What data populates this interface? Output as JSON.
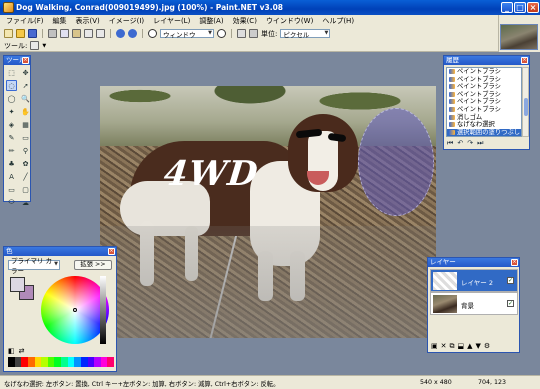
{
  "window": {
    "title": "Dog Walking, Conrad(009019499).jpg (100%) - Paint.NET v3.08"
  },
  "menu": {
    "items": [
      "ファイル(F)",
      "編集",
      "表示(V)",
      "イメージ(I)",
      "レイヤー(L)",
      "調整(A)",
      "効果(C)",
      "ウインドウ(W)",
      "ヘルプ(H)"
    ]
  },
  "toolbar": {
    "zoom_label": "ウィンドウ",
    "units_label": "単位:",
    "units_value": "ピクセル",
    "tools_label": "ツール:"
  },
  "canvas": {
    "painted_text": "4WD"
  },
  "tools_panel": {
    "title": "ツール"
  },
  "history_panel": {
    "title": "履歴",
    "items": [
      "ペイントブラシ",
      "ペイントブラシ",
      "ペイントブラシ",
      "ペイントブラシ",
      "ペイントブラシ",
      "ペイントブラシ",
      "消しゴム",
      "なげなわ選択",
      "選択範囲の塗りつぶし"
    ]
  },
  "colors_panel": {
    "title": "色",
    "mode": "プライマリ カラー",
    "more_button": "拡張 >>",
    "primary_color": "#dcd7e2",
    "secondary_color": "#b08ab8"
  },
  "layers_panel": {
    "title": "レイヤー",
    "layers": [
      {
        "name": "レイヤー 2",
        "visible": true
      },
      {
        "name": "背景",
        "visible": true
      }
    ]
  },
  "status": {
    "hint": "なげなわ選択: 左ボタン: 置換, Ctrl キー+左ボタン: 加算, 右ボタン: 減算, Ctrl+右ボタン: 反転。",
    "image_size": "540 x 480",
    "cursor_pos": "704, 123"
  }
}
